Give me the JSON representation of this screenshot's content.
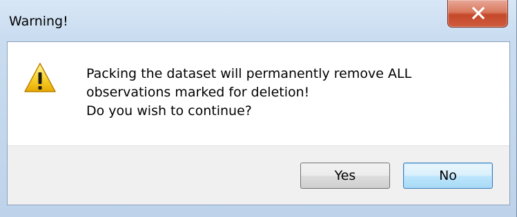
{
  "window": {
    "title": "Warning!",
    "close_icon": "close-icon"
  },
  "dialog": {
    "icon": "warning-icon",
    "message_lines": [
      "Packing the dataset will permanently remove ALL",
      "observations marked for deletion!",
      "Do you wish to continue?"
    ]
  },
  "buttons": {
    "yes_label": "Yes",
    "no_label": "No"
  },
  "colors": {
    "warning_yellow": "#f5c500",
    "close_red": "#c5492b",
    "default_button_blue": "#3c7fb1"
  }
}
